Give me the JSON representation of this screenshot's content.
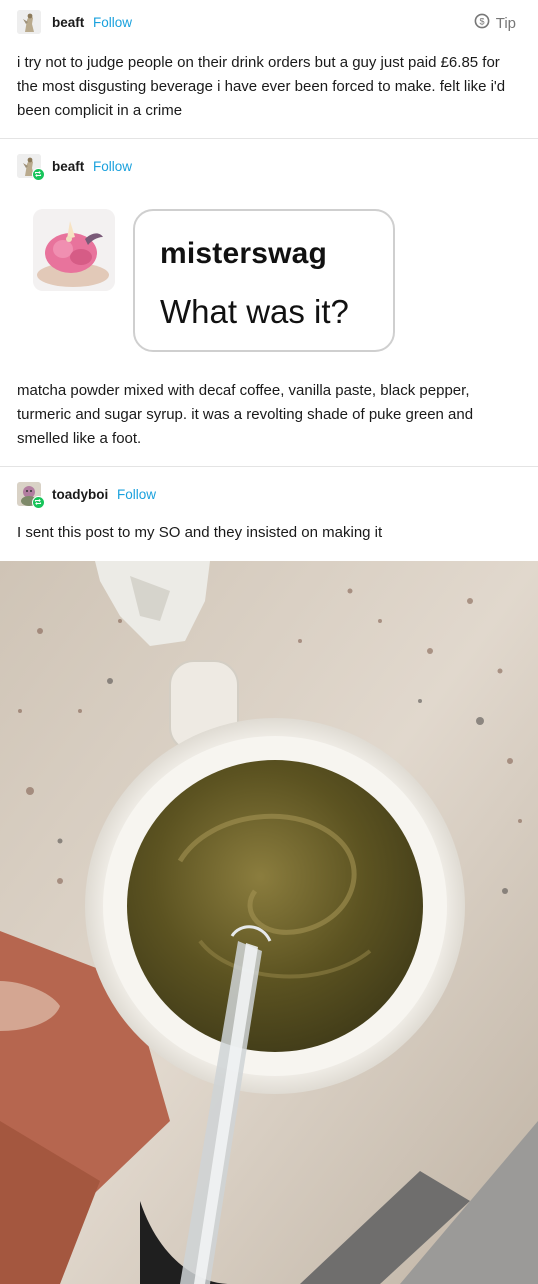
{
  "post1": {
    "username": "beaft",
    "follow_label": "Follow",
    "tip_label": "Tip",
    "text": "i try not to judge people on their drink orders but a guy just paid £6.85 for the most disgusting beverage i have ever been forced to make. felt like i'd been complicit in a crime"
  },
  "post2": {
    "username": "beaft",
    "follow_label": "Follow",
    "ask": {
      "asker": "misterswag",
      "question": "What was it?"
    },
    "text": "matcha powder mixed with decaf coffee, vanilla paste, black pepper, turmeric and sugar syrup. it was a revolting shade of puke green and smelled like a foot."
  },
  "post3": {
    "username": "toadyboi",
    "follow_label": "Follow",
    "text": "I sent this post to my SO and they insisted on making it"
  },
  "icons": {
    "tip": "coin-icon",
    "reblog": "reblog-icon"
  },
  "colors": {
    "follow": "#1aa1dd",
    "reblog_badge": "#17c45a",
    "divider": "#e4e4e4"
  }
}
